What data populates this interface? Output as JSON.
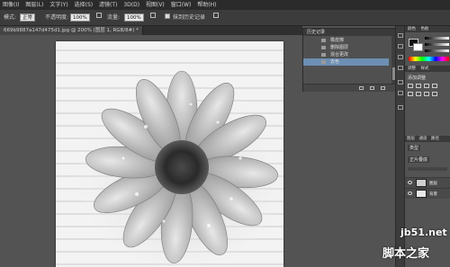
{
  "menubar": {
    "items": [
      "图像(I)",
      "图层(L)",
      "文字(Y)",
      "选择(S)",
      "滤镜(T)",
      "3D(D)",
      "视图(V)",
      "窗口(W)",
      "帮助(H)"
    ]
  },
  "options": {
    "mode_label": "模式:",
    "mode_value": "正常",
    "opacity_label": "不透明度:",
    "opacity_value": "100%",
    "flow_label": "流量:",
    "flow_value": "100%",
    "erase_history_label": "抹到历史记录"
  },
  "document_tab": {
    "label": "669b9887a147d475d1.jpg @ 200% (图层 1, RGB/8#) *"
  },
  "history_panel": {
    "tab_label": "历史记录",
    "items": [
      "橡皮擦",
      "删除图层",
      "混合更改",
      "去色"
    ],
    "selected_index": 3
  },
  "right_panel": {
    "tabs_top": [
      "颜色",
      "色板"
    ],
    "adjust_tabs": [
      "调整",
      "样式"
    ],
    "add_adjust_label": "添加调整",
    "layers_tabs": [
      "图层",
      "通道",
      "路径"
    ],
    "kind_label": "类型",
    "blend_mode": "正片叠底",
    "layers": [
      {
        "name": "图层"
      },
      {
        "name": "背景"
      }
    ]
  },
  "watermark": {
    "site": "jb51.net",
    "brand": "脚本之家"
  }
}
